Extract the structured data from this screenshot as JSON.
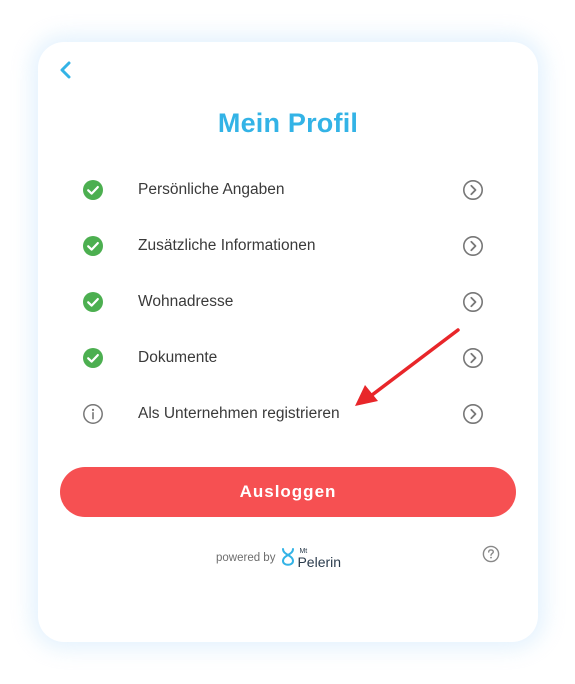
{
  "header": {
    "title": "Mein Profil",
    "back_icon": "chevron-left-icon"
  },
  "menu": {
    "items": [
      {
        "label": "Persönliche Angaben",
        "status": "completed",
        "status_icon": "check-circle-icon",
        "action_icon": "chevron-right-circle-icon"
      },
      {
        "label": "Zusätzliche Informationen",
        "status": "completed",
        "status_icon": "check-circle-icon",
        "action_icon": "chevron-right-circle-icon"
      },
      {
        "label": "Wohnadresse",
        "status": "completed",
        "status_icon": "check-circle-icon",
        "action_icon": "chevron-right-circle-icon"
      },
      {
        "label": "Dokumente",
        "status": "completed",
        "status_icon": "check-circle-icon",
        "action_icon": "chevron-right-circle-icon"
      },
      {
        "label": "Als Unternehmen registrieren",
        "status": "info",
        "status_icon": "info-circle-icon",
        "action_icon": "chevron-right-circle-icon"
      }
    ]
  },
  "actions": {
    "logout_label": "Ausloggen"
  },
  "footer": {
    "powered_by": "powered by",
    "brand_prefix": "Mt",
    "brand_name": "Pelerin",
    "help_icon": "question-circle-icon"
  },
  "colors": {
    "accent": "#33b3e6",
    "success": "#4caf50",
    "danger": "#f65052",
    "text": "#3a3a3a",
    "muted_icon": "#777777",
    "annotation": "#e8262a"
  }
}
